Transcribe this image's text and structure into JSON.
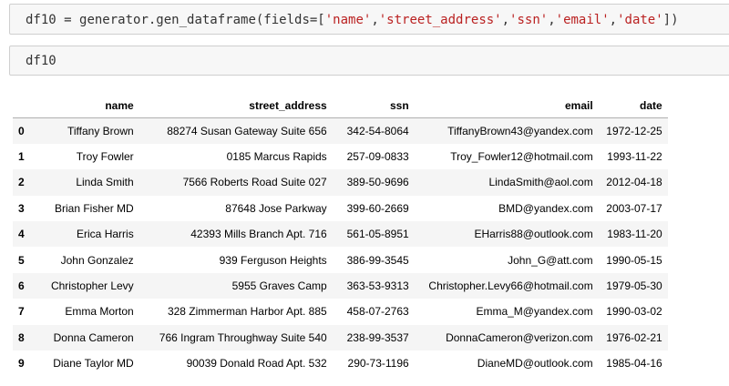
{
  "cells": {
    "code1": {
      "var": "df10",
      "op": " = ",
      "call": "generator.gen_dataframe(fields=[",
      "args": [
        "'name'",
        "'street_address'",
        "'ssn'",
        "'email'",
        "'date'"
      ],
      "sep": ",",
      "close": "])"
    },
    "code2": "df10"
  },
  "table": {
    "columns": [
      "name",
      "street_address",
      "ssn",
      "email",
      "date"
    ],
    "rows": [
      {
        "index": "0",
        "cells": [
          "Tiffany Brown",
          "88274 Susan Gateway Suite 656",
          "342-54-8064",
          "TiffanyBrown43@yandex.com",
          "1972-12-25"
        ]
      },
      {
        "index": "1",
        "cells": [
          "Troy Fowler",
          "0185 Marcus Rapids",
          "257-09-0833",
          "Troy_Fowler12@hotmail.com",
          "1993-11-22"
        ]
      },
      {
        "index": "2",
        "cells": [
          "Linda Smith",
          "7566 Roberts Road Suite 027",
          "389-50-9696",
          "LindaSmith@aol.com",
          "2012-04-18"
        ]
      },
      {
        "index": "3",
        "cells": [
          "Brian Fisher MD",
          "87648 Jose Parkway",
          "399-60-2669",
          "BMD@yandex.com",
          "2003-07-17"
        ]
      },
      {
        "index": "4",
        "cells": [
          "Erica Harris",
          "42393 Mills Branch Apt. 716",
          "561-05-8951",
          "EHarris88@outlook.com",
          "1983-11-20"
        ]
      },
      {
        "index": "5",
        "cells": [
          "John Gonzalez",
          "939 Ferguson Heights",
          "386-99-3545",
          "John_G@att.com",
          "1990-05-15"
        ]
      },
      {
        "index": "6",
        "cells": [
          "Christopher Levy",
          "5955 Graves Camp",
          "363-53-9313",
          "Christopher.Levy66@hotmail.com",
          "1979-05-30"
        ]
      },
      {
        "index": "7",
        "cells": [
          "Emma Morton",
          "328 Zimmerman Harbor Apt. 885",
          "458-07-2763",
          "Emma_M@yandex.com",
          "1990-03-02"
        ]
      },
      {
        "index": "8",
        "cells": [
          "Donna Cameron",
          "766 Ingram Throughway Suite 540",
          "238-99-3537",
          "DonnaCameron@verizon.com",
          "1976-02-21"
        ]
      },
      {
        "index": "9",
        "cells": [
          "Diane Taylor MD",
          "90039 Donald Road Apt. 532",
          "290-73-1196",
          "DianeMD@outlook.com",
          "1985-04-16"
        ]
      }
    ]
  },
  "colors": {
    "string": "#ba2121",
    "cell_bg": "#f7f7f7",
    "row_stripe": "#f5f5f5"
  }
}
